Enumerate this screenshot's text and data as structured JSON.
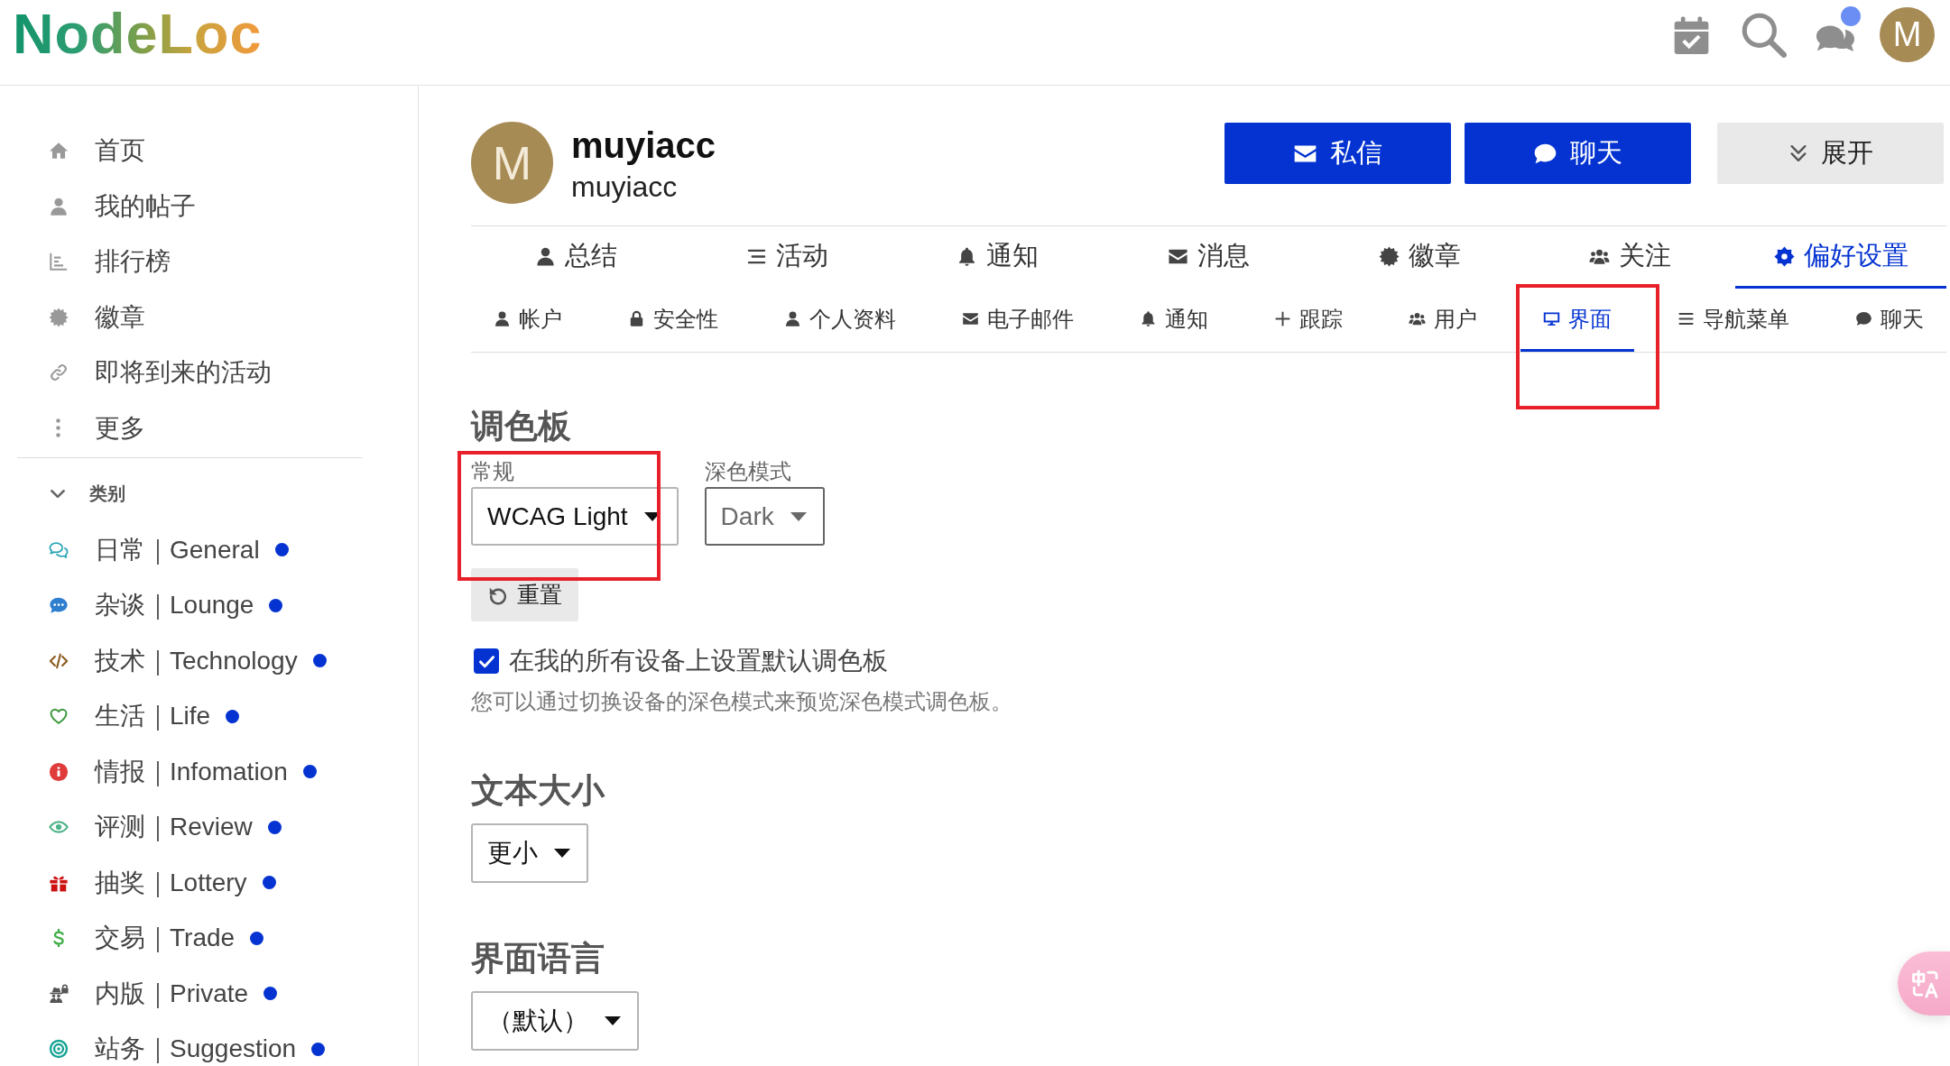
{
  "header": {
    "logo": "NodeLoc",
    "chat_unread": true,
    "avatar_letter": "M"
  },
  "sidebar": {
    "nav_items": [
      {
        "label": "首页"
      },
      {
        "label": "我的帖子"
      },
      {
        "label": "排行榜"
      },
      {
        "label": "徽章"
      },
      {
        "label": "即将到来的活动"
      },
      {
        "label": "更多"
      }
    ],
    "categories": {
      "title": "类别",
      "expanded": true,
      "items": [
        {
          "label": "日常｜General",
          "color": "#2ba5b5",
          "unread": true
        },
        {
          "label": "杂谈｜Lounge",
          "color": "#2e7fd0",
          "unread": true
        },
        {
          "label": "技术｜Technology",
          "color": "#8b5a1e",
          "unread": true
        },
        {
          "label": "生活｜Life",
          "color": "#3f9a3f",
          "unread": true
        },
        {
          "label": "情报｜Infomation",
          "color": "#e03b3b",
          "unread": true
        },
        {
          "label": "评测｜Review",
          "color": "#4cb387",
          "unread": true
        },
        {
          "label": "抽奖｜Lottery",
          "color": "#cc1111",
          "unread": true
        },
        {
          "label": "交易｜Trade",
          "color": "#3fae49",
          "unread": true
        },
        {
          "label": "内版｜Private",
          "color": "#555555",
          "unread": true
        },
        {
          "label": "站务｜Suggestion",
          "color": "#16a394",
          "unread": true
        }
      ]
    }
  },
  "profile": {
    "avatar_letter": "M",
    "name": "muyiacc",
    "username": "muyiacc",
    "buttons": [
      {
        "label": "私信",
        "kind": "primary"
      },
      {
        "label": "聊天",
        "kind": "primary"
      },
      {
        "label": "展开",
        "kind": "secondary"
      }
    ]
  },
  "tabs": [
    {
      "label": "总结",
      "selected": false
    },
    {
      "label": "活动",
      "selected": false
    },
    {
      "label": "通知",
      "selected": false
    },
    {
      "label": "消息",
      "selected": false
    },
    {
      "label": "徽章",
      "selected": false
    },
    {
      "label": "关注",
      "selected": false
    },
    {
      "label": "偏好设置",
      "selected": true
    }
  ],
  "sub_tabs": [
    {
      "label": "帐户",
      "selected": false,
      "highlighted": false
    },
    {
      "label": "安全性",
      "selected": false,
      "highlighted": false
    },
    {
      "label": "个人资料",
      "selected": false,
      "highlighted": false
    },
    {
      "label": "电子邮件",
      "selected": false,
      "highlighted": false
    },
    {
      "label": "通知",
      "selected": false,
      "highlighted": false
    },
    {
      "label": "跟踪",
      "selected": false,
      "highlighted": false
    },
    {
      "label": "用户",
      "selected": false,
      "highlighted": false
    },
    {
      "label": "界面",
      "selected": true,
      "highlighted": true
    },
    {
      "label": "导航菜单",
      "selected": false,
      "highlighted": false
    },
    {
      "label": "聊天",
      "selected": false,
      "highlighted": false
    }
  ],
  "palette": {
    "title": "调色板",
    "selects": [
      {
        "label": "常规",
        "value": "WCAG Light",
        "highlighted": true
      },
      {
        "label": "深色模式",
        "value": "Dark",
        "highlighted": false
      }
    ],
    "reset_button": "重置",
    "default_checkbox": {
      "label": "在我的所有设备上设置默认调色板",
      "checked": true
    },
    "hint": "您可以通过切换设备的深色模式来预览深色模式调色板。"
  },
  "text_size": {
    "title": "文本大小",
    "value": "更小"
  },
  "interface_language": {
    "title": "界面语言",
    "value": "（默认）"
  }
}
